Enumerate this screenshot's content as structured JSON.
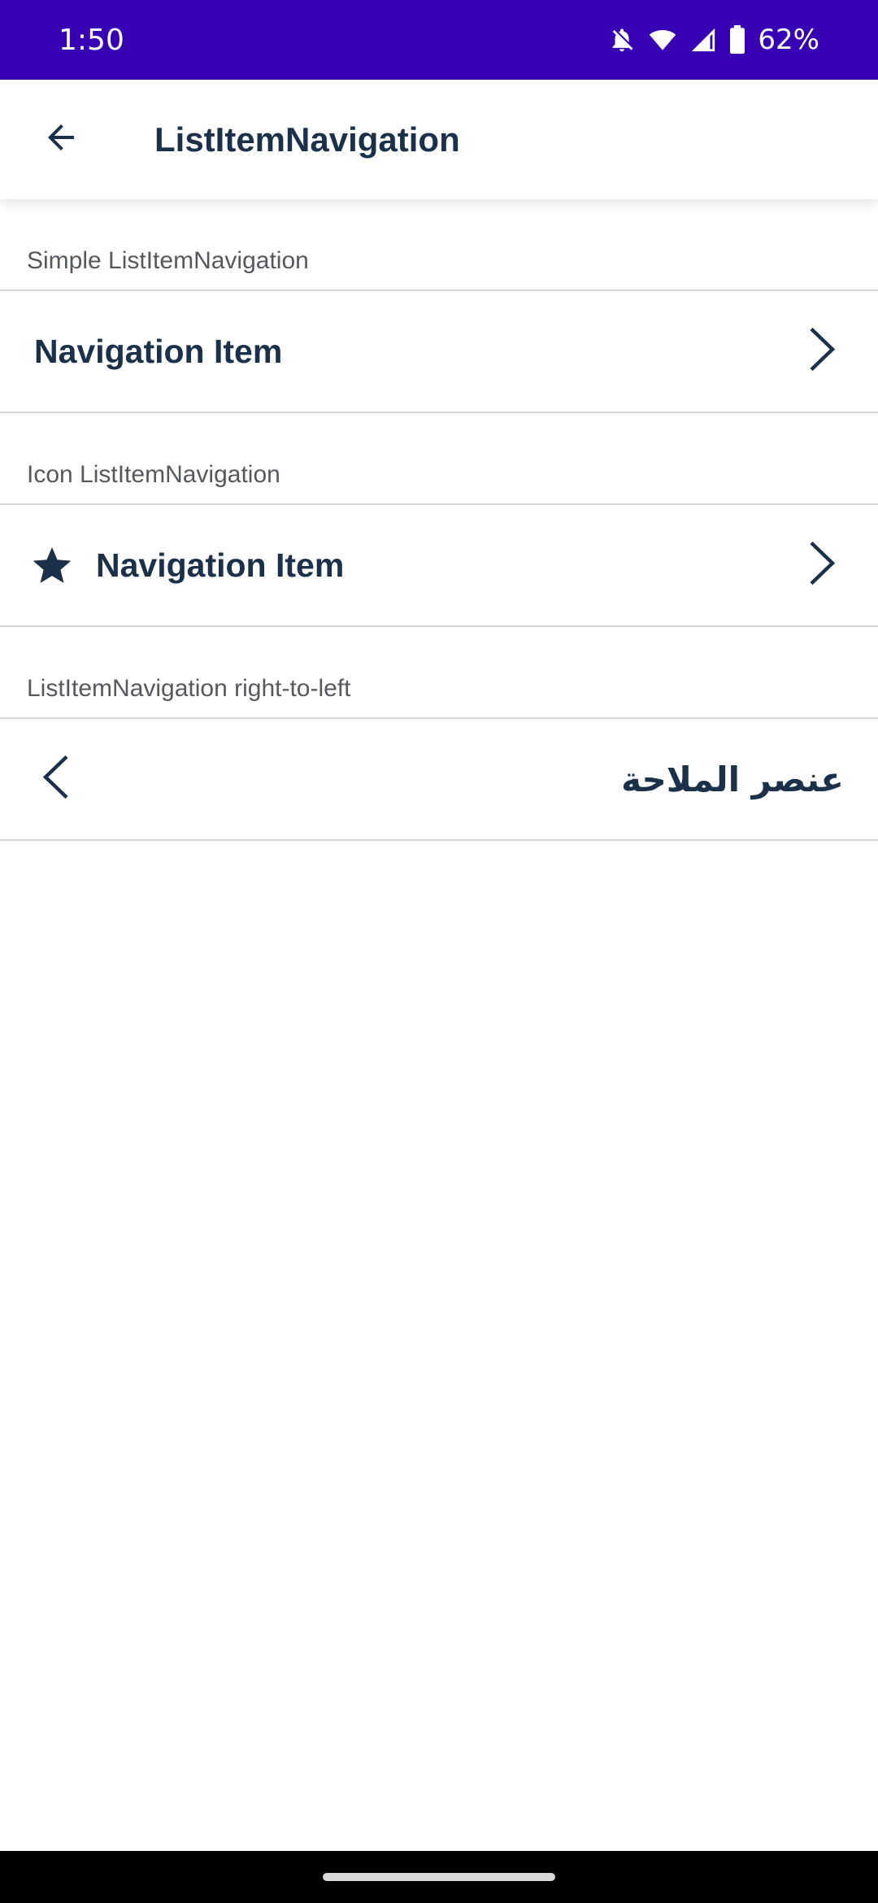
{
  "status_bar": {
    "time": "1:50",
    "battery": "62%",
    "icons": [
      "notifications-off-icon",
      "wifi-icon",
      "cell-signal-icon",
      "battery-icon"
    ]
  },
  "app_bar": {
    "title": "ListItemNavigation",
    "back_icon": "arrow-back-icon"
  },
  "sections": [
    {
      "label": "Simple ListItemNavigation",
      "item_label": "Navigation Item"
    },
    {
      "label": "Icon ListItemNavigation",
      "item_label": "Navigation Item",
      "icon": "star-icon"
    },
    {
      "label": "ListItemNavigation right-to-left",
      "item_label": "عنصر الملاحة"
    }
  ],
  "colors": {
    "status_bar": "#3700b3",
    "text_primary": "#1b3049",
    "text_secondary": "#55595e",
    "divider": "#d6d6d6"
  }
}
